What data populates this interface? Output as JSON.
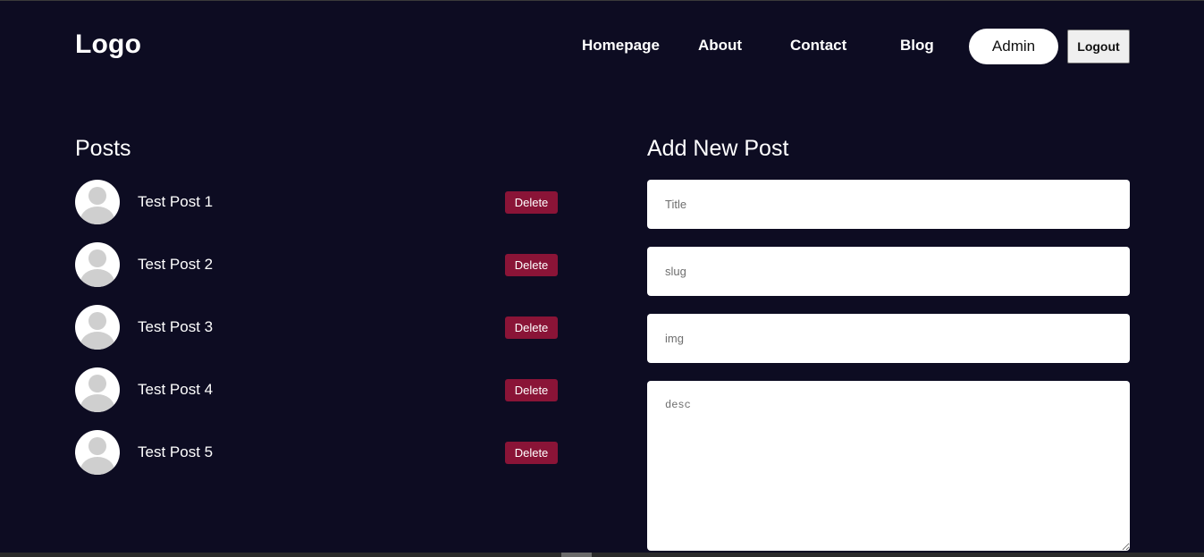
{
  "header": {
    "logo": "Logo",
    "nav": {
      "homepage": "Homepage",
      "about": "About",
      "contact": "Contact",
      "blog": "Blog"
    },
    "admin_label": "Admin",
    "logout_label": "Logout"
  },
  "posts": {
    "title": "Posts",
    "delete_label": "Delete",
    "items": [
      {
        "title": "Test Post 1"
      },
      {
        "title": "Test Post 2"
      },
      {
        "title": "Test Post 3"
      },
      {
        "title": "Test Post 4"
      },
      {
        "title": "Test Post 5"
      }
    ]
  },
  "form": {
    "title": "Add New Post",
    "title_placeholder": "Title",
    "slug_placeholder": "slug",
    "img_placeholder": "img",
    "desc_placeholder": "desc"
  },
  "colors": {
    "background": "#0d0c22",
    "delete_button": "#8a1437",
    "admin_button": "#ffffff"
  },
  "icons": {
    "avatar": "user-avatar-icon"
  }
}
